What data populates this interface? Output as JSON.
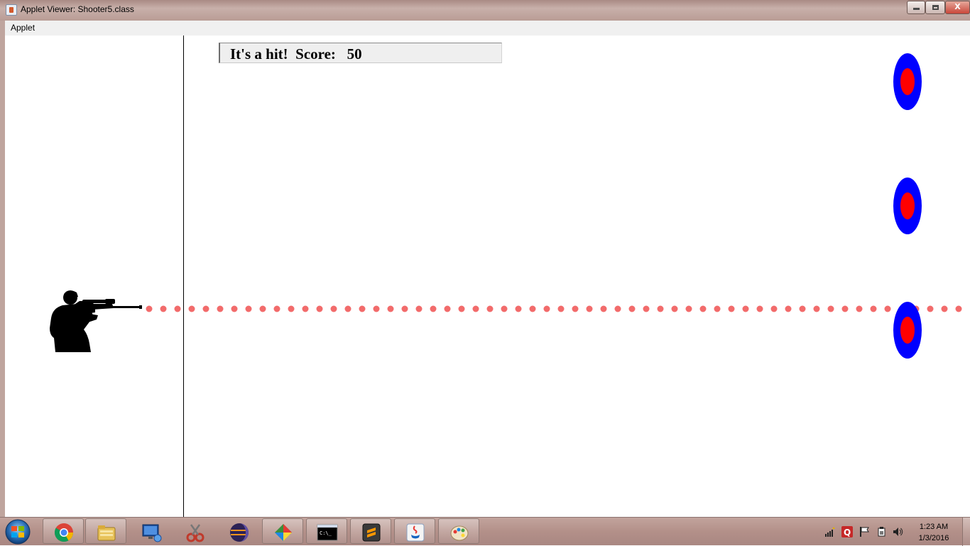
{
  "window": {
    "title": "Applet Viewer: Shooter5.class",
    "icon": "java-applet-icon",
    "controls": [
      "minimize-icon",
      "maximize-icon",
      "close-icon"
    ],
    "close_glyph": "X"
  },
  "menubar": {
    "items": [
      {
        "label": "Applet"
      }
    ]
  },
  "game": {
    "status_text": "It's a hit!  Score:   50",
    "colors": {
      "target_outer": "#0000ff",
      "target_inner": "#ff0000",
      "bullet": "#f26b6b",
      "shooter": "#000000",
      "boundary_line": "#000000"
    },
    "shooter_icon": "rifle-shooter-silhouette",
    "target_icon": "bullseye-target",
    "target_count": 3
  },
  "taskbar": {
    "start_icon": "windows-start-orb-icon",
    "pinned": [
      "chrome-icon",
      "file-explorer-icon",
      "remote-desktop-icon",
      "snipping-tool-icon",
      "eclipse-icon",
      "gadget-app-icon",
      "command-prompt-icon",
      "sublime-text-icon",
      "java-icon",
      "paint-icon"
    ],
    "tray_icons": [
      "network-icon",
      "q-app-icon",
      "action-center-flag-icon",
      "power-icon",
      "volume-icon"
    ],
    "clock": {
      "time": "1:23 AM",
      "date": "1/3/2016"
    }
  }
}
